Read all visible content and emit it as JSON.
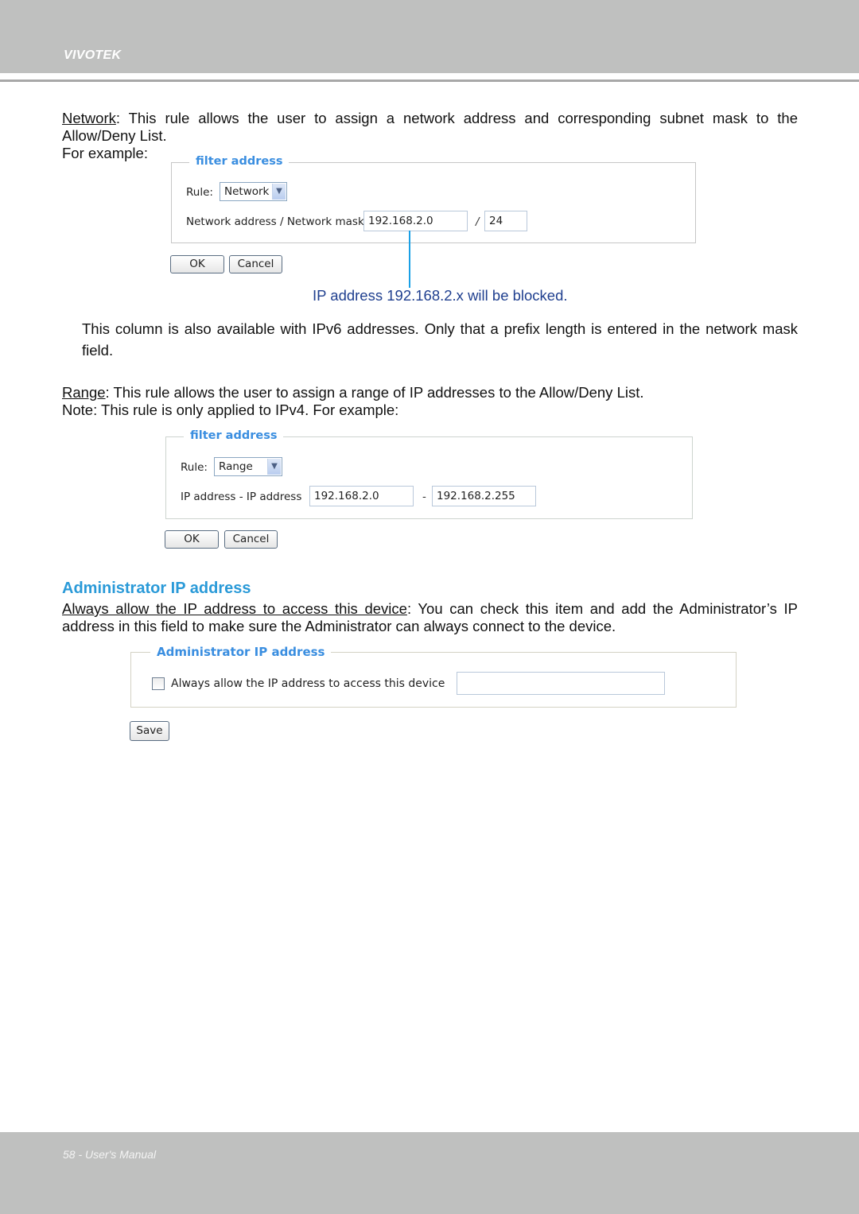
{
  "header": {
    "brand": "VIVOTEK"
  },
  "network_section": {
    "term": "Network",
    "description": ": This rule allows the user to assign a network address and corresponding subnet mask to the Allow/Deny List.",
    "for_example": "For example:"
  },
  "network_panel": {
    "legend": "filter address",
    "rule_label": "Rule:",
    "rule_value": "Network",
    "field_label": "Network address / Network mask",
    "address_value": "192.168.2.0",
    "separator": "/",
    "mask_value": "24",
    "ok_label": "OK",
    "cancel_label": "Cancel"
  },
  "network_caption": "IP address 192.168.2.x will be blocked.",
  "ipv6_note": "This column is also available with IPv6 addresses. Only that a prefix length is entered in the network mask field.",
  "range_section": {
    "term": "Range",
    "description": ": This rule allows the user to assign a range of IP addresses to the Allow/Deny List.",
    "note": "Note: This rule is only applied to IPv4. For example:"
  },
  "range_panel": {
    "legend": "filter address",
    "rule_label": "Rule:",
    "rule_value": "Range",
    "field_label": "IP address - IP address",
    "start_value": "192.168.2.0",
    "separator": "-",
    "end_value": "192.168.2.255",
    "ok_label": "OK",
    "cancel_label": "Cancel"
  },
  "admin_section": {
    "title": "Administrator IP address",
    "term": "Always allow the IP address to access this device",
    "description": ": You can check this item and add the Administrator’s IP address in this field to make sure the Administrator can always connect to the device."
  },
  "admin_panel": {
    "legend": "Administrator IP address",
    "checkbox_label": "Always allow the IP address to access this device",
    "checkbox_checked": false,
    "ip_value": "",
    "save_label": "Save"
  },
  "footer": {
    "page_label": "58 - User's Manual"
  }
}
